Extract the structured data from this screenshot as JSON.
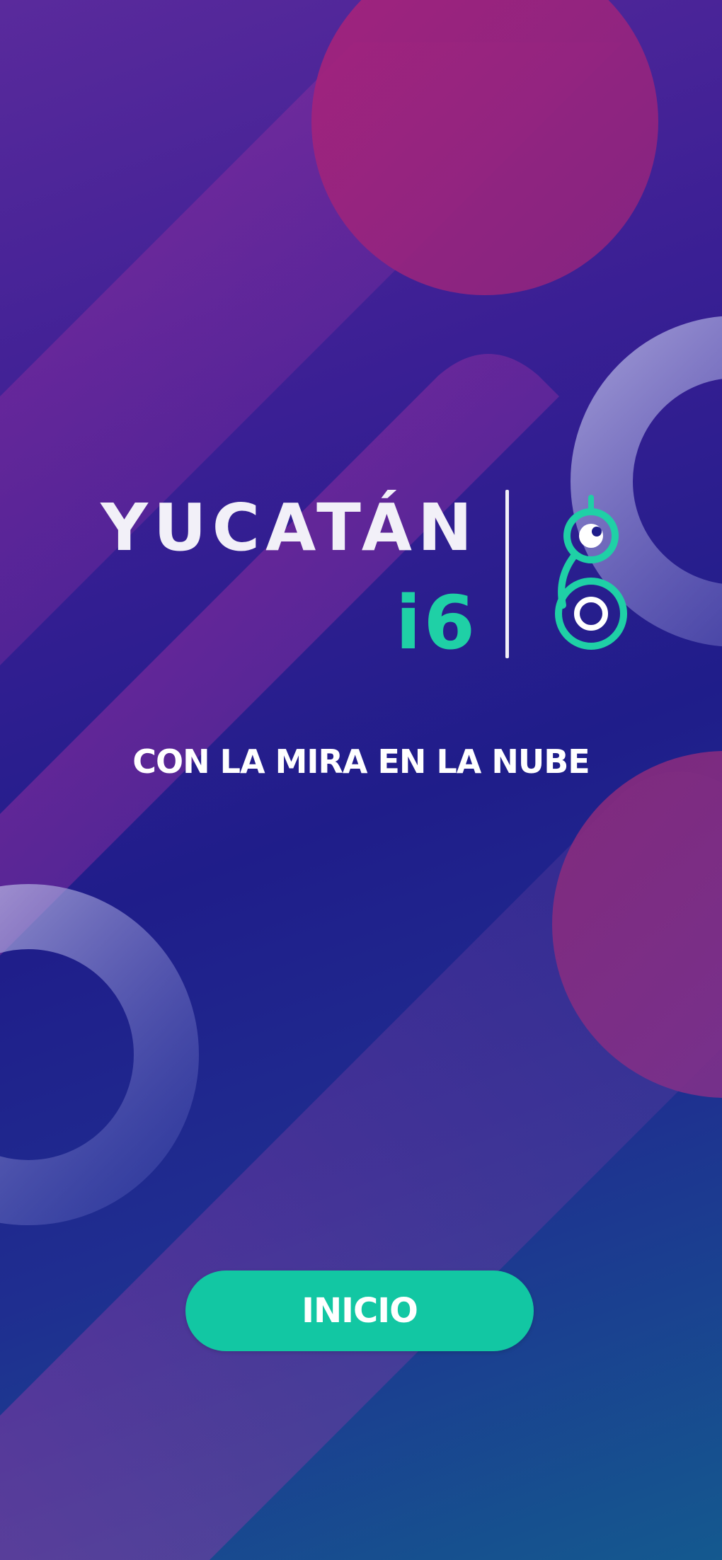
{
  "brand": {
    "name": "YUCATÁN",
    "edition": "i6",
    "emblem_icon": "figure-eight-emblem-icon",
    "accent_color": "#1fd0a6"
  },
  "tagline": "CON LA MIRA EN LA NUBE",
  "buttons": {
    "start_label": "INICIO",
    "start_color": "#12c7a3"
  }
}
